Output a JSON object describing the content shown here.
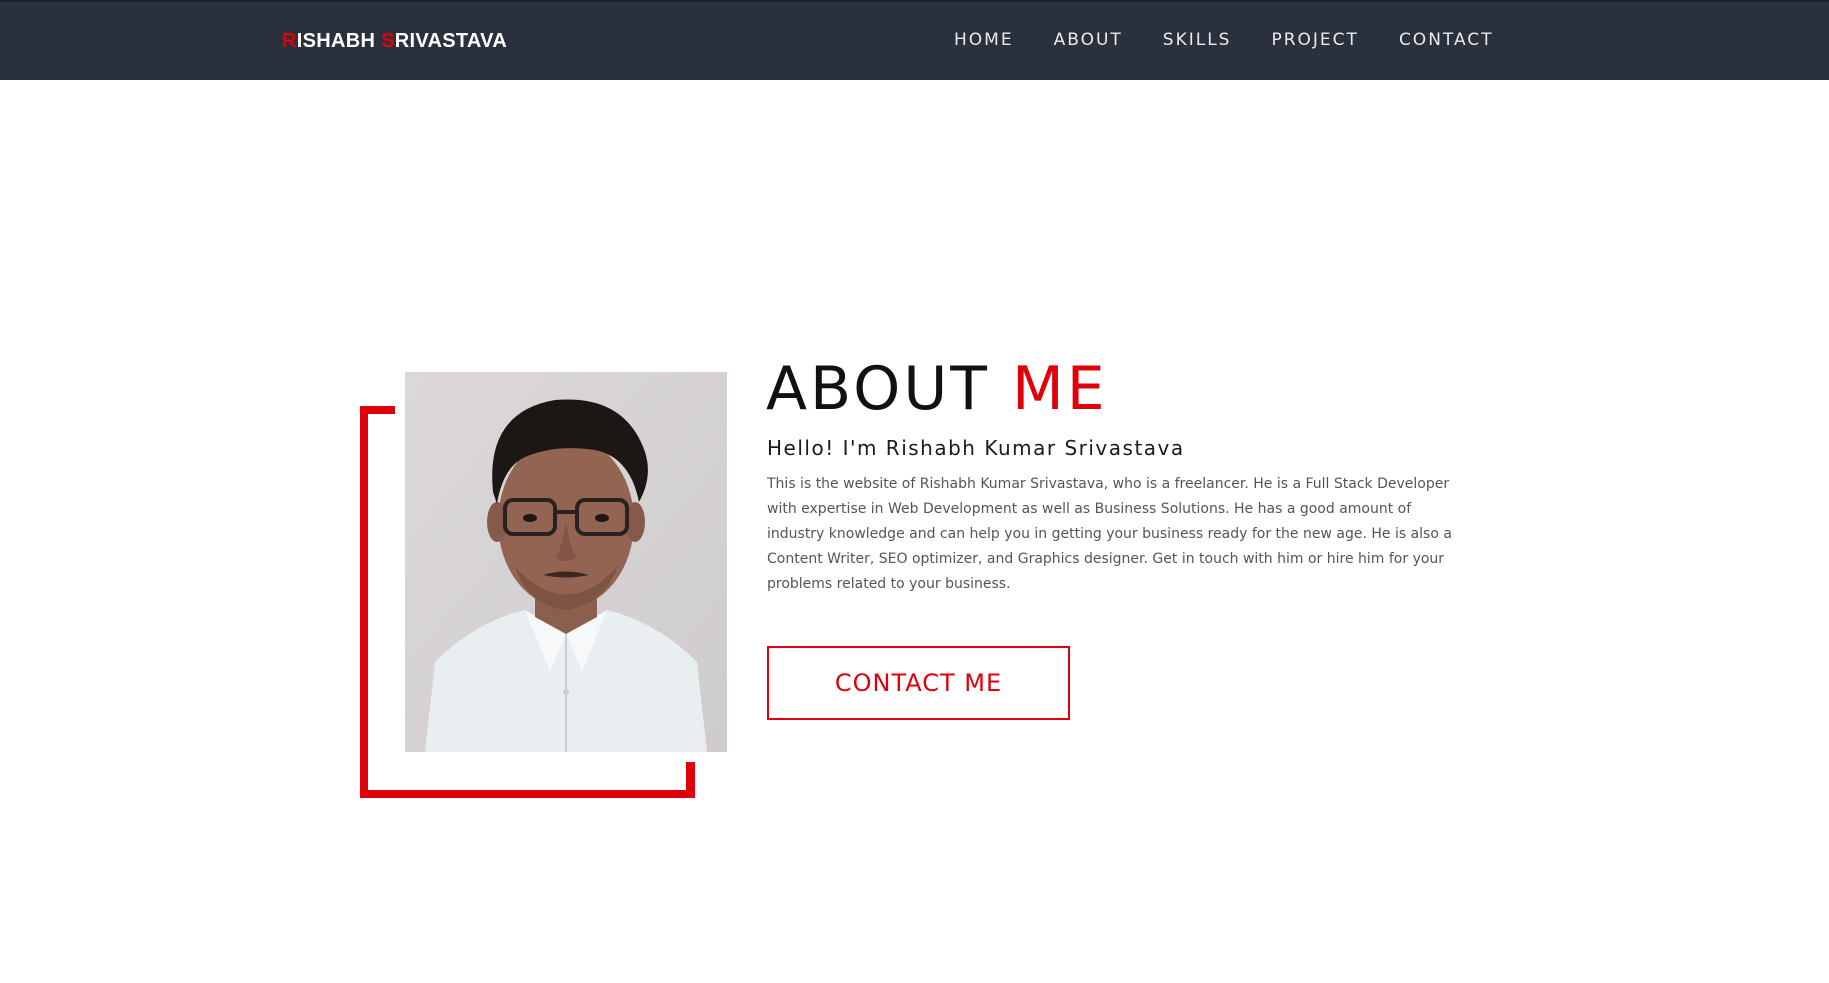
{
  "navbar": {
    "brand": {
      "first_initial": "R",
      "first_rest": "ISHABH",
      "last_initial": "S",
      "last_rest": "RIVASTAVA"
    },
    "links": [
      {
        "label": "HOME"
      },
      {
        "label": "ABOUT"
      },
      {
        "label": "SKILLS"
      },
      {
        "label": "PROJECT"
      },
      {
        "label": "CONTACT"
      }
    ]
  },
  "about": {
    "title_main": "ABOUT",
    "title_accent": "ME",
    "greeting": "Hello! I'm Rishabh Kumar Srivastava",
    "bio": "This is the website of Rishabh Kumar Srivastava, who is a freelancer. He is a Full Stack Developer with expertise in Web Development as well as Business Solutions. He has a good amount of industry knowledge and can help you in getting your business ready for the new age. He is also a Content Writer, SEO optimizer, and Graphics designer. Get in touch with him or hire him for your problems related to your business.",
    "cta_label": "CONTACT ME"
  },
  "colors": {
    "navbar_bg": "#2a313d",
    "accent_red": "#e0000b",
    "nav_text": "#e8eaee",
    "body_text": "#555555"
  }
}
